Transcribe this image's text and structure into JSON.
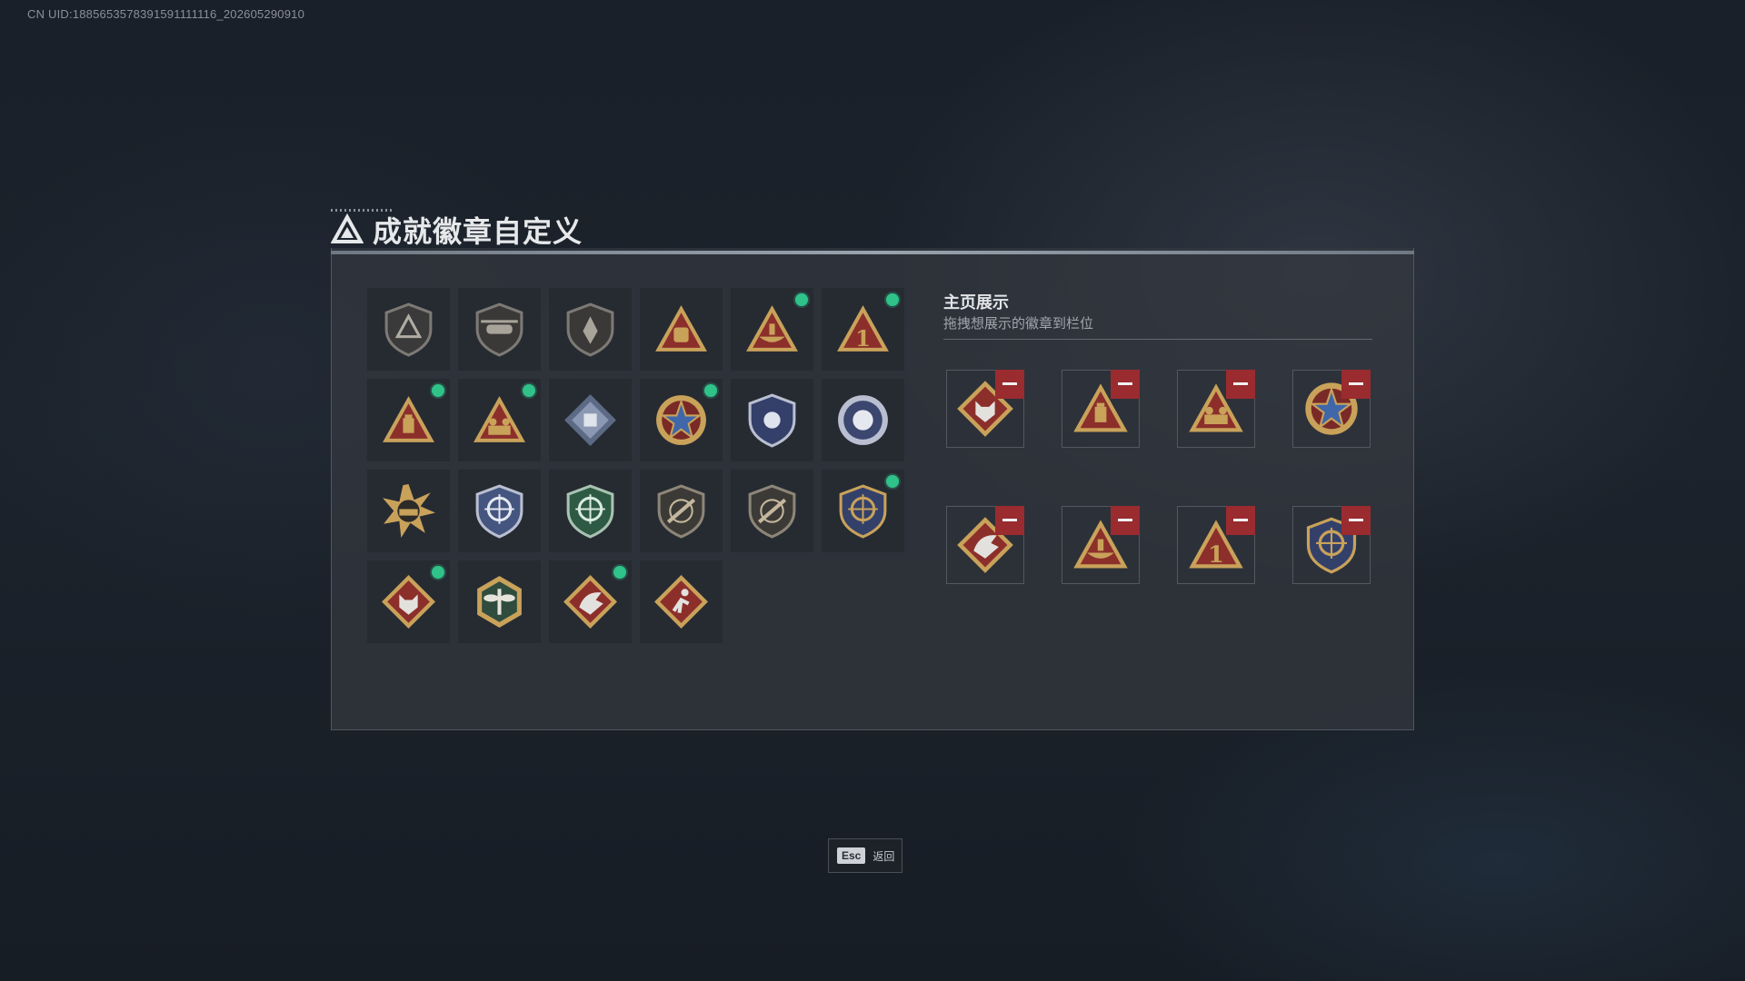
{
  "uid_text": "CN UID:1885653578391591111116_202605290910",
  "title": "成就徽章自定义",
  "showcase": {
    "title": "主页展示",
    "subtitle": "拖拽想展示的徽章到栏位"
  },
  "esc": {
    "key": "Esc",
    "label": "返回"
  },
  "colors": {
    "new_dot": "#2fc38a",
    "remove_button": "#9a2b2f",
    "gold": "#c9a25a",
    "red": "#8c2f2b"
  },
  "badges": [
    {
      "icon": "shield-triangle-badge",
      "new": false
    },
    {
      "icon": "helicopter-shield-badge",
      "new": false
    },
    {
      "icon": "arrow-shield-badge",
      "new": false
    },
    {
      "icon": "hand-sign-badge",
      "new": false
    },
    {
      "icon": "ship-triangle-badge",
      "new": true
    },
    {
      "icon": "number-one-badge",
      "new": true
    },
    {
      "icon": "ammo-triangle-badge",
      "new": true
    },
    {
      "icon": "soldiers-triangle-badge",
      "new": true
    },
    {
      "icon": "crate-diamond-badge",
      "new": false
    },
    {
      "icon": "star-medal-badge",
      "new": true
    },
    {
      "icon": "police-shield-badge",
      "new": false
    },
    {
      "icon": "rose-emblem-badge",
      "new": false
    },
    {
      "icon": "tank-burst-badge",
      "new": false
    },
    {
      "icon": "crosshair-blue-badge",
      "new": false
    },
    {
      "icon": "crosshair-green-badge",
      "new": false
    },
    {
      "icon": "rifle-shield-badge",
      "new": false
    },
    {
      "icon": "rifle-shield-2-badge",
      "new": false
    },
    {
      "icon": "gold-crosshair-wreath-badge",
      "new": true
    },
    {
      "icon": "wolf-diamond-badge",
      "new": true
    },
    {
      "icon": "dragonfly-hexagon-badge",
      "new": false
    },
    {
      "icon": "dragon-diamond-badge",
      "new": true
    },
    {
      "icon": "runner-diamond-badge",
      "new": false
    }
  ],
  "showcase_slots": [
    {
      "icon": "wolf-diamond-badge"
    },
    {
      "icon": "ammo-triangle-badge"
    },
    {
      "icon": "soldiers-triangle-badge"
    },
    {
      "icon": "star-medal-badge"
    },
    {
      "icon": "dragon-diamond-badge"
    },
    {
      "icon": "ship-triangle-badge"
    },
    {
      "icon": "number-one-badge"
    },
    {
      "icon": "gold-crosshair-wreath-badge"
    }
  ]
}
